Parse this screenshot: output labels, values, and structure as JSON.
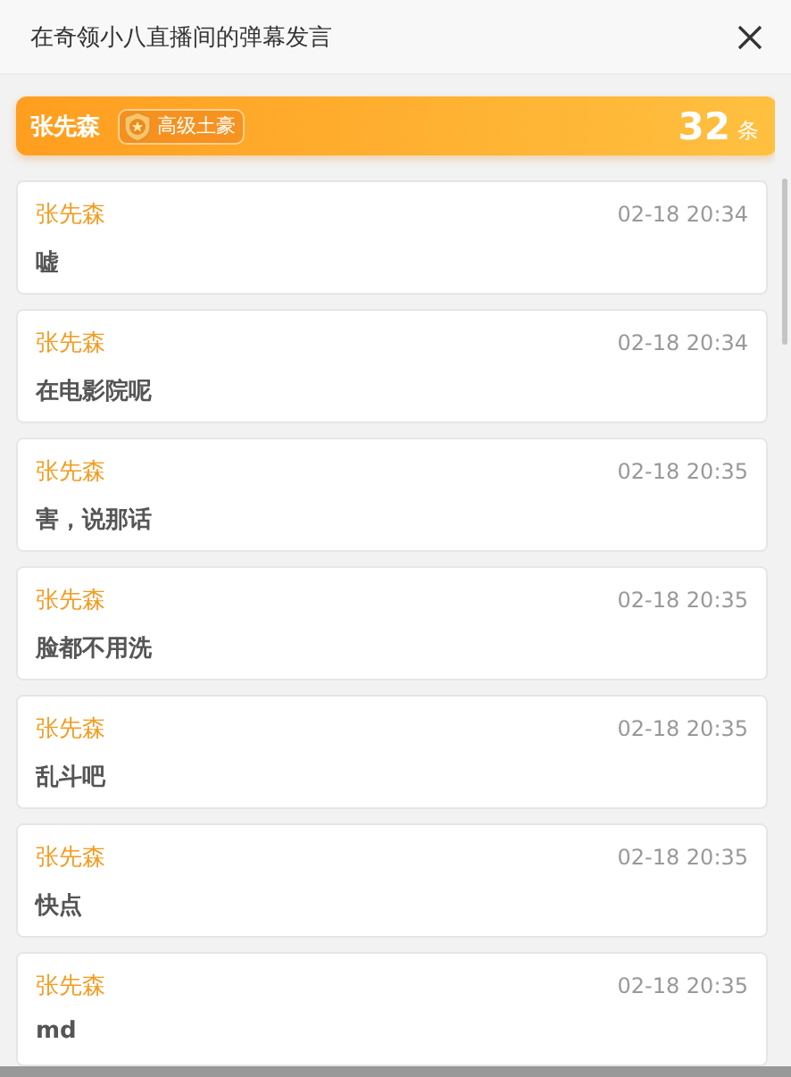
{
  "window": {
    "title": "在奇领小八直播间的弹幕发言"
  },
  "summary": {
    "user": "张先森",
    "badge": "高级土豪",
    "count": "32",
    "unit": "条"
  },
  "messages": [
    {
      "user": "张先森",
      "time": "02-18 20:34",
      "text": "嘘"
    },
    {
      "user": "张先森",
      "time": "02-18 20:34",
      "text": "在电影院呢"
    },
    {
      "user": "张先森",
      "time": "02-18 20:35",
      "text": "害，说那话"
    },
    {
      "user": "张先森",
      "time": "02-18 20:35",
      "text": "脸都不用洗"
    },
    {
      "user": "张先森",
      "time": "02-18 20:35",
      "text": "乱斗吧"
    },
    {
      "user": "张先森",
      "time": "02-18 20:35",
      "text": "快点"
    },
    {
      "user": "张先森",
      "time": "02-18 20:35",
      "text": "md"
    }
  ]
}
